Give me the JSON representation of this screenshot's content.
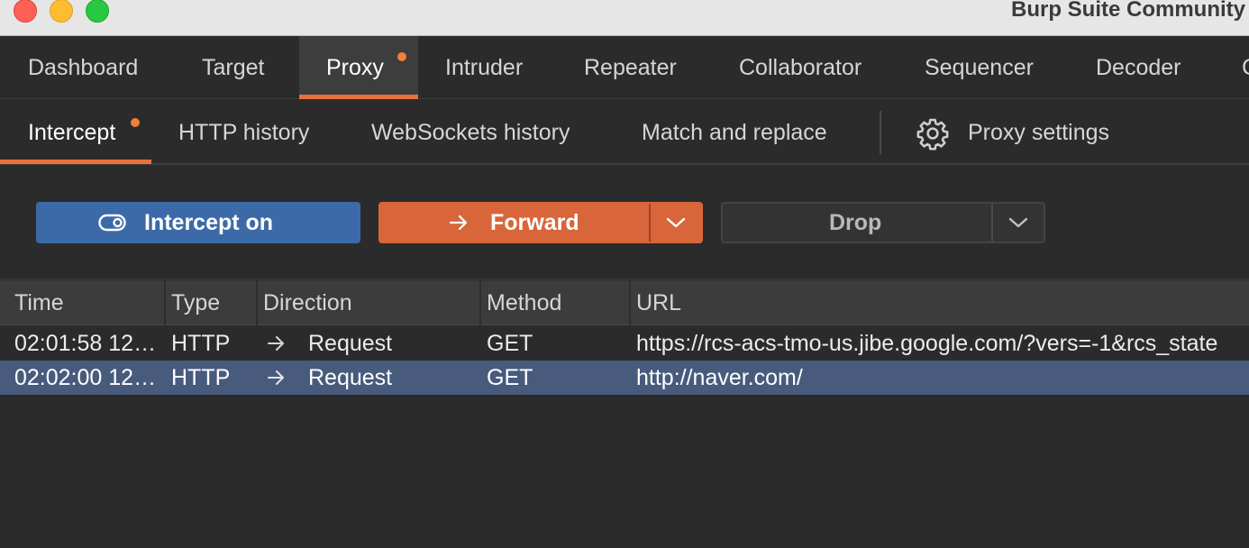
{
  "window": {
    "title": "Burp Suite Community"
  },
  "main_tabs": [
    {
      "label": "Dashboard",
      "active": false
    },
    {
      "label": "Target",
      "active": false
    },
    {
      "label": "Proxy",
      "active": true,
      "notification": true
    },
    {
      "label": "Intruder",
      "active": false
    },
    {
      "label": "Repeater",
      "active": false
    },
    {
      "label": "Collaborator",
      "active": false
    },
    {
      "label": "Sequencer",
      "active": false
    },
    {
      "label": "Decoder",
      "active": false
    }
  ],
  "sub_tabs": [
    {
      "label": "Intercept",
      "active": true,
      "notification": true
    },
    {
      "label": "HTTP history",
      "active": false
    },
    {
      "label": "WebSockets history",
      "active": false
    },
    {
      "label": "Match and replace",
      "active": false
    },
    {
      "label": "Proxy settings",
      "icon": "gear-icon"
    }
  ],
  "toolbar": {
    "intercept_label": "Intercept on",
    "intercept_icon": "toggle-icon",
    "forward_label": "Forward",
    "forward_icon": "arrow-right-icon",
    "drop_label": "Drop",
    "dropdown_icon": "chevron-down-icon"
  },
  "table": {
    "columns": [
      "Time",
      "Type",
      "Direction",
      "Method",
      "URL"
    ],
    "rows": [
      {
        "time": "02:01:58 12…",
        "type": "HTTP",
        "direction": "Request",
        "method": "GET",
        "url": "https://rcs-acs-tmo-us.jibe.google.com/?vers=-1&rcs_state",
        "selected": false
      },
      {
        "time": "02:02:00 12…",
        "type": "HTTP",
        "direction": "Request",
        "method": "GET",
        "url": "http://naver.com/",
        "selected": true
      }
    ]
  },
  "colors": {
    "accent_orange": "#e8703a",
    "intercept_blue": "#3c6aa8",
    "forward_orange": "#d8663a",
    "selected_row": "#485b7d",
    "background": "#2b2b2b"
  }
}
